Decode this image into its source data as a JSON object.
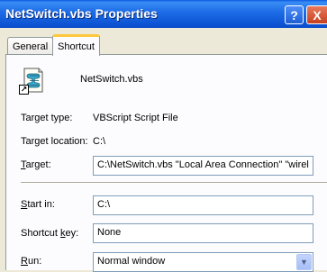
{
  "window": {
    "title": "NetSwitch.vbs Properties",
    "help_label": "?",
    "close_label": "X"
  },
  "tabs": [
    {
      "label": "General",
      "selected": false
    },
    {
      "label": "Shortcut",
      "selected": true
    }
  ],
  "file": {
    "name": "NetSwitch.vbs",
    "icon": "vbscript-shortcut-icon"
  },
  "info": {
    "target_type_label": "Target type:",
    "target_type_value": "VBScript Script File",
    "target_location_label": "Target location:",
    "target_location_value": "C:\\"
  },
  "fields": {
    "target_label_pre": "",
    "target_label_accel": "T",
    "target_label_post": "arget:",
    "target_value": "C:\\NetSwitch.vbs \"Local Area Connection\" \"wirel",
    "start_in_label_pre": "",
    "start_in_label_accel": "S",
    "start_in_label_post": "tart in:",
    "start_in_value": "C:\\",
    "shortcut_key_label_pre": "Shortcut ",
    "shortcut_key_label_accel": "k",
    "shortcut_key_label_post": "ey:",
    "shortcut_key_value": "None",
    "run_label_pre": "",
    "run_label_accel": "R",
    "run_label_post": "un:",
    "run_value": "Normal window"
  },
  "colors": {
    "titlebar": "#0a5ae0",
    "tab_highlight": "#ffc83c",
    "dialog_bg": "#ece9d8"
  }
}
